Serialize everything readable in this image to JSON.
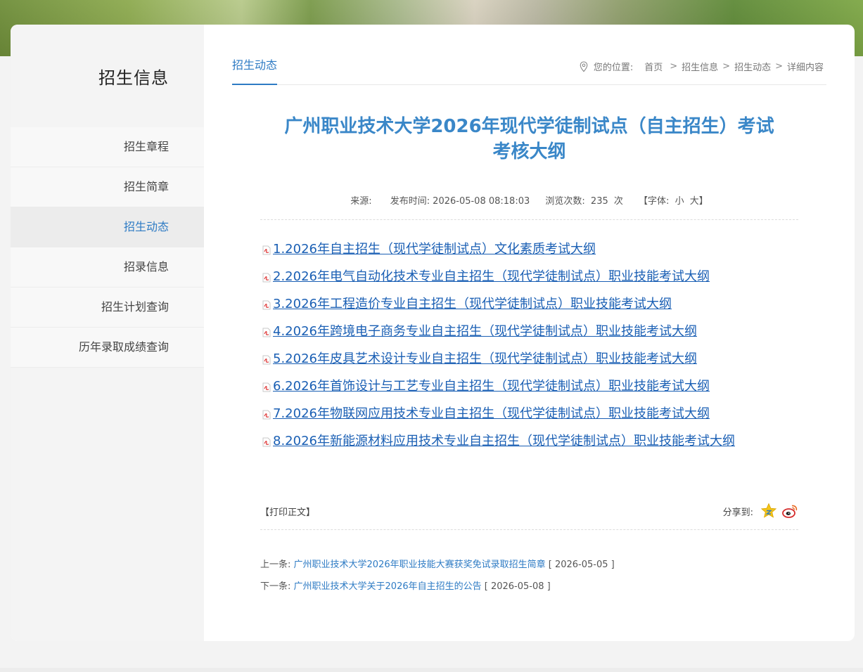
{
  "sidebar": {
    "title": "招生信息",
    "items": [
      {
        "label": "招生章程",
        "active": false
      },
      {
        "label": "招生简章",
        "active": false
      },
      {
        "label": "招生动态",
        "active": true
      },
      {
        "label": "招录信息",
        "active": false
      },
      {
        "label": "招生计划查询",
        "active": false
      },
      {
        "label": "历年录取成绩查询",
        "active": false
      }
    ]
  },
  "tab": {
    "label": "招生动态"
  },
  "breadcrumb": {
    "lead": "您的位置:",
    "items": [
      "首页",
      "招生信息",
      "招生动态",
      "详细内容"
    ],
    "separator": ">"
  },
  "article": {
    "title_line1": "广州职业技术大学2026年现代学徒制试点（自主招生）考试",
    "title_line2": "考核大纲",
    "source_label": "来源:",
    "source_value": "",
    "publish_label": "发布时间:",
    "publish_value": "2026-05-08 08:18:03",
    "views_label": "浏览次数:",
    "views_value": "235",
    "views_unit": "次",
    "font_label": "【字体:",
    "font_small": "小",
    "font_large": "大】",
    "attachments": [
      "1.2026年自主招生（现代学徒制试点）文化素质考试大纲",
      "2.2026年电气自动化技术专业自主招生（现代学徒制试点）职业技能考试大纲",
      "3.2026年工程造价专业自主招生（现代学徒制试点）职业技能考试大纲",
      "4.2026年跨境电子商务专业自主招生（现代学徒制试点）职业技能考试大纲",
      "5.2026年皮具艺术设计专业自主招生（现代学徒制试点）职业技能考试大纲",
      "6.2026年首饰设计与工艺专业自主招生（现代学徒制试点）职业技能考试大纲",
      "7.2026年物联网应用技术专业自主招生（现代学徒制试点）职业技能考试大纲",
      "8.2026年新能源材料应用技术专业自主招生（现代学徒制试点）职业技能考试大纲"
    ]
  },
  "actions": {
    "print_label": "【打印正文】",
    "share_label": "分享到:"
  },
  "pagination": {
    "prev_label": "上一条:",
    "prev_title": "广州职业技术大学2026年职业技能大赛获奖免试录取招生简章",
    "prev_date": "[ 2026-05-05 ]",
    "next_label": "下一条:",
    "next_title": "广州职业技术大学关于2026年自主招生的公告",
    "next_date": "[ 2026-05-08 ]"
  },
  "colors": {
    "accent": "#2e7bc4",
    "title": "#3a87c8",
    "link": "#1a5fb4"
  }
}
